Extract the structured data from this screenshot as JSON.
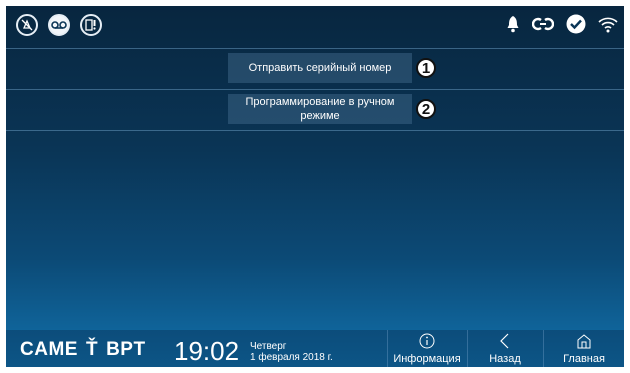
{
  "topbar": {
    "left_icons": [
      "mute-bell-icon",
      "voicemail-icon",
      "door-phone-icon"
    ],
    "right_icons": [
      "bell-icon",
      "link-icon",
      "checkmark-icon",
      "wifi-icon"
    ]
  },
  "menu": {
    "items": [
      {
        "label": "Отправить серийный номер",
        "callout": "1"
      },
      {
        "label": "Программирование в ручном режиме",
        "callout": "2"
      }
    ]
  },
  "footer": {
    "brand_left": "CAME",
    "brand_right": "BPT",
    "time": "19:02",
    "weekday": "Четверг",
    "date": "1 февраля 2018 г.",
    "buttons": [
      {
        "label": "Информация",
        "icon": "info-icon"
      },
      {
        "label": "Назад",
        "icon": "back-chevron-icon"
      },
      {
        "label": "Главная",
        "icon": "home-icon"
      }
    ]
  },
  "colors": {
    "accent": "#1171ac",
    "background_top": "#08263f"
  }
}
